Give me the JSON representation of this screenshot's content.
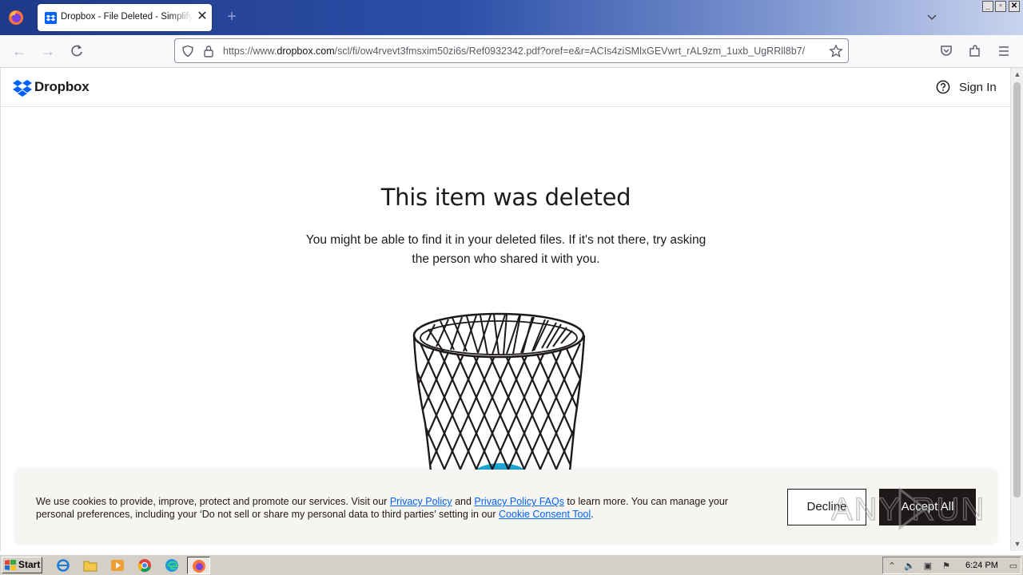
{
  "browser": {
    "tab_title": "Dropbox - File Deleted - Simplify your life",
    "tab_close": "✕",
    "new_tab": "+",
    "url_prefix": "https://www.",
    "url_domain": "dropbox.com",
    "url_path": "/scl/fi/ow4rvevt3fmsxim50zi6s/Ref0932342.pdf?oref=e&r=ACIs4ziSMlxGEVwrt_rAL9zm_1uxb_UgRRll8b7/",
    "window_buttons": [
      "_",
      "▫",
      "✕"
    ]
  },
  "site": {
    "brand": "Dropbox",
    "signin": "Sign In"
  },
  "main": {
    "heading": "This item was deleted",
    "subtext": "You might be able to find it in your deleted files. If it's not there, try asking the person who shared it with you."
  },
  "cookie": {
    "text_1": "We use cookies to provide, improve, protect and promote our services. Visit our ",
    "link_privacy": "Privacy Policy",
    "text_2": " and ",
    "link_faq": "Privacy Policy FAQs",
    "text_3": " to learn more. You can manage your personal preferences, including your ‘Do not sell or share my personal data to third parties’ setting in our ",
    "link_consent": "Cookie Consent Tool",
    "text_4": ".",
    "decline": "Decline",
    "accept": "Accept All"
  },
  "watermark": "ANY RUN",
  "taskbar": {
    "start": "Start",
    "clock": "6:24 PM"
  },
  "colors": {
    "dropbox_blue": "#0061fe",
    "ink": "#1e1919",
    "banner_bg": "#f7f5f2",
    "trash_liquid": "#1ea7d6"
  }
}
